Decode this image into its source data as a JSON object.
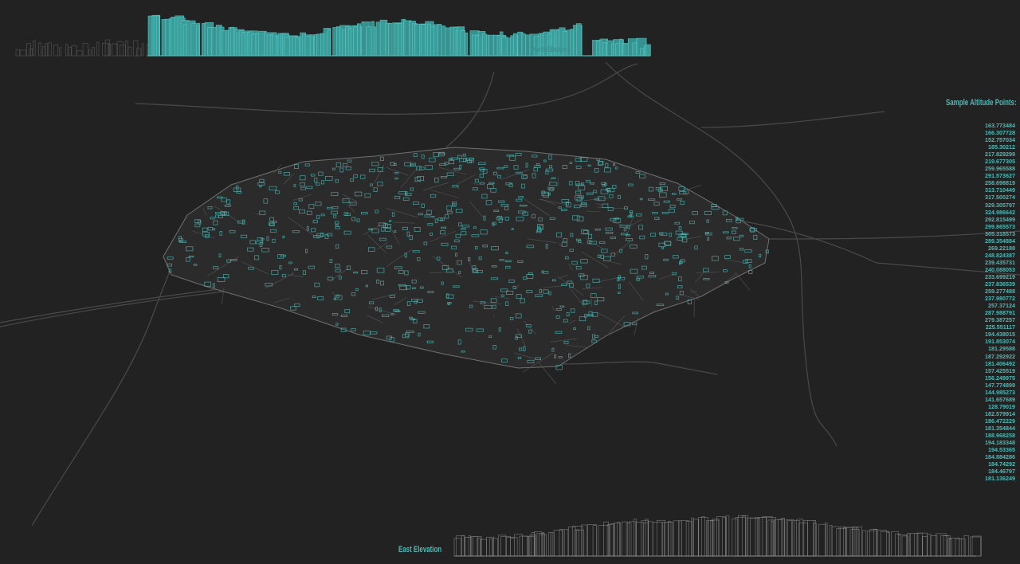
{
  "north_elevation": {
    "label": "North Elevation"
  },
  "east_elevation": {
    "label": "East Elevation"
  },
  "altitude_points": {
    "title": "Sample Altitude Points:",
    "values": [
      "163.773484",
      "166.307728",
      "152.757034",
      "185.30212",
      "217.829299",
      "219.677305",
      "259.965588",
      "291.573627",
      "258.698819",
      "313.710449",
      "317.500274",
      "329.305797",
      "324.986642",
      "292.815499",
      "299.865573",
      "305.318573",
      "289.354884",
      "269.22188",
      "248.824387",
      "239.435731",
      "240.088053",
      "233.699219",
      "237.836539",
      "259.277488",
      "237.980772",
      "257.37124",
      "287.988791",
      "279.387257",
      "225.551117",
      "194.438015",
      "191.853074",
      "181.29588",
      "187.292922",
      "181.406492",
      "157.425519",
      "156.249975",
      "147.774899",
      "144.985273",
      "141.657689",
      "128.79019",
      "182.579914",
      "186.472229",
      "181.354844",
      "188.968258",
      "194.183348",
      "194.53365",
      "184.884286",
      "184.74292",
      "184.46797",
      "181.136249"
    ]
  },
  "colors": {
    "background": "#222222",
    "accent": "#4fb8b5",
    "linework": "#6a6a6a"
  }
}
